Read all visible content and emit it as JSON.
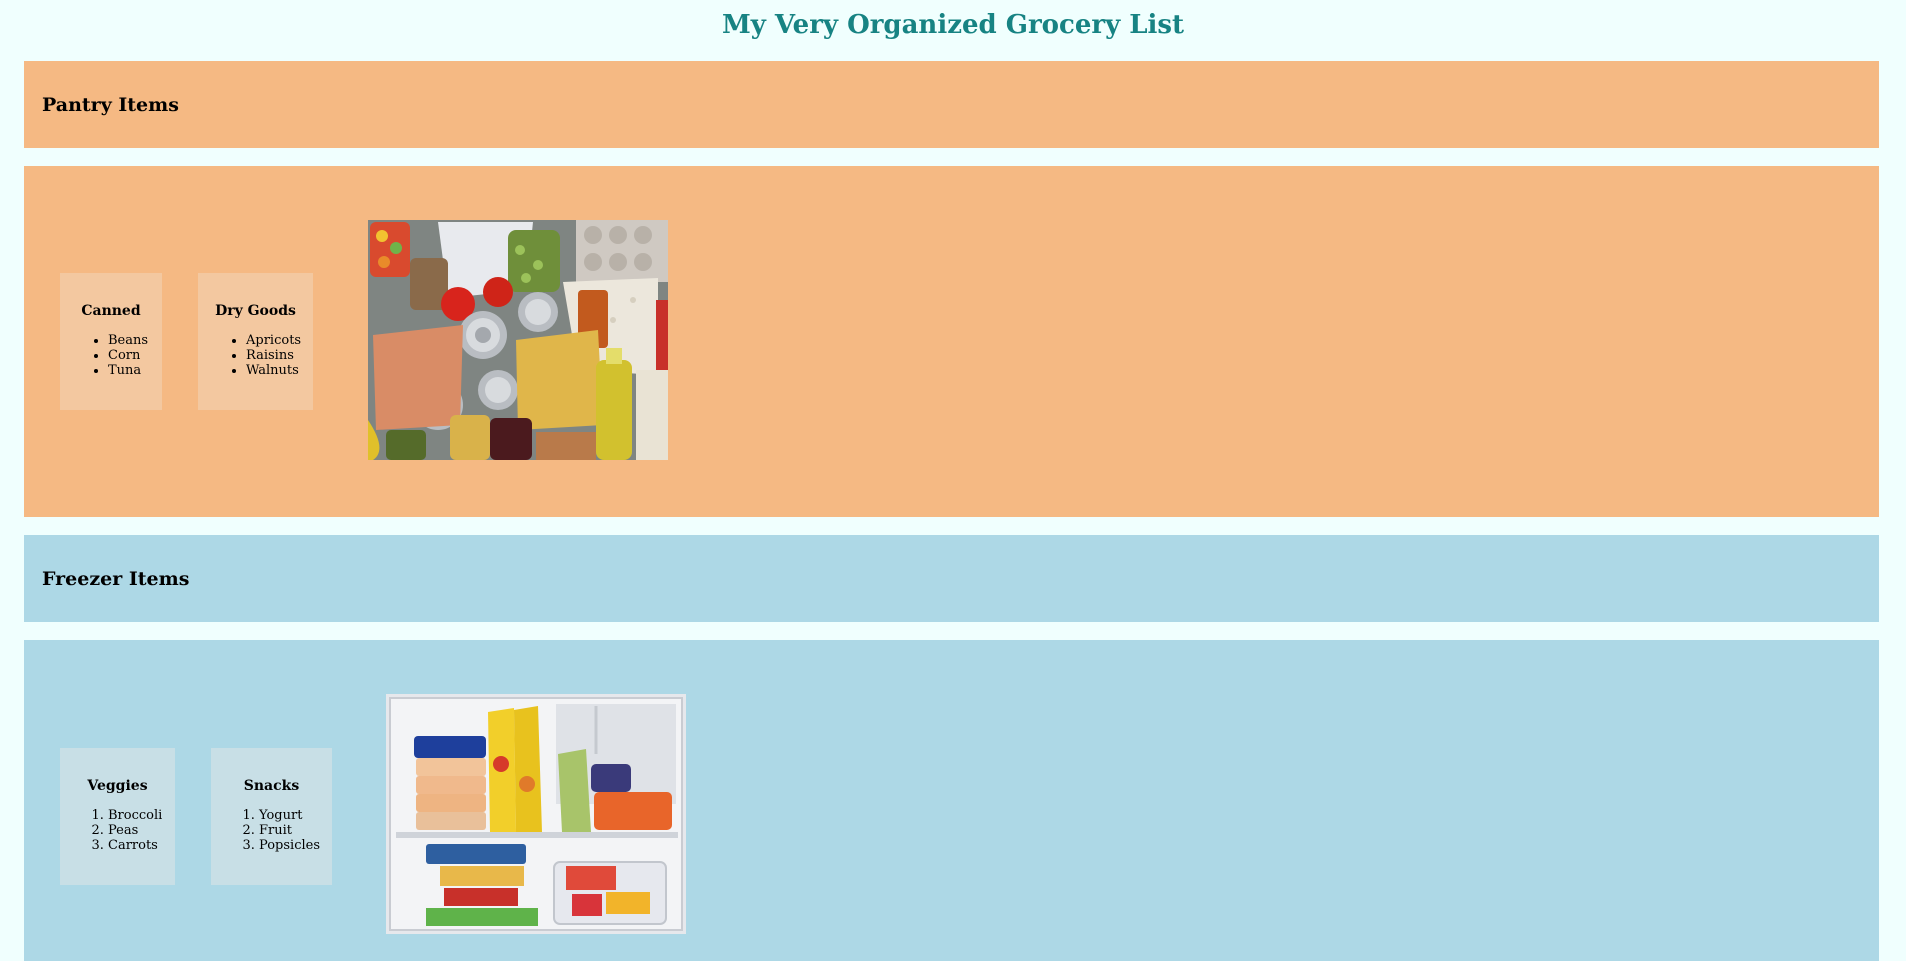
{
  "page": {
    "title": "My Very Organized Grocery List"
  },
  "pantry": {
    "heading": "Pantry Items",
    "color": "#f5b983",
    "groups": [
      {
        "title": "Canned",
        "items": [
          "Beans",
          "Corn",
          "Tuna"
        ]
      },
      {
        "title": "Dry Goods",
        "items": [
          "Apricots",
          "Raisins",
          "Walnuts"
        ]
      }
    ],
    "image_icon": "pantry-groceries-photo"
  },
  "freezer": {
    "heading": "Freezer Items",
    "color": "#add8e6",
    "groups": [
      {
        "title": "Veggies",
        "items": [
          "Broccoli",
          "Peas",
          "Carrots"
        ]
      },
      {
        "title": "Snacks",
        "items": [
          "Yogurt",
          "Fruit",
          "Popsicles"
        ]
      }
    ],
    "image_icon": "freezer-contents-photo"
  }
}
